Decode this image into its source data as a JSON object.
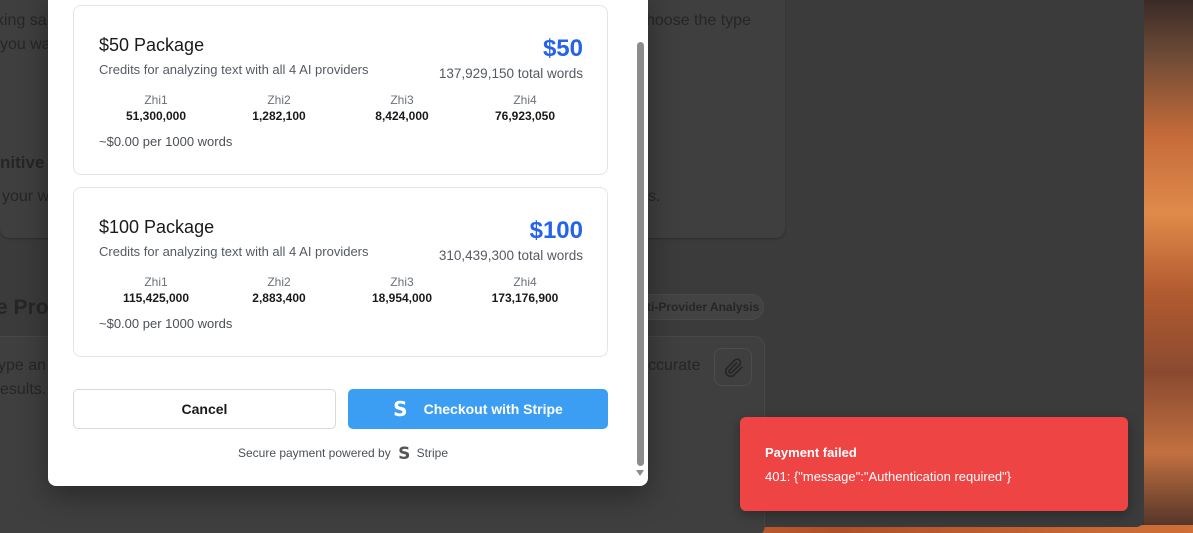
{
  "background": {
    "text_fragments": [
      "king sa",
      "you wa",
      "nitive",
      "your w",
      "e Profi",
      "ype an",
      "esults.",
      "hoose the type",
      "s.",
      "ccurate"
    ],
    "pill_label": "ti-Provider Analysis"
  },
  "modal": {
    "packages": [
      {
        "title": "$50 Package",
        "description": "Credits for analyzing text with all 4 AI providers",
        "price": "$50",
        "total_words": "137,929,150 total words",
        "providers": [
          {
            "name": "Zhi1",
            "value": "51,300,000"
          },
          {
            "name": "Zhi2",
            "value": "1,282,100"
          },
          {
            "name": "Zhi3",
            "value": "8,424,000"
          },
          {
            "name": "Zhi4",
            "value": "76,923,050"
          }
        ],
        "rate": "~$0.00 per 1000 words"
      },
      {
        "title": "$100 Package",
        "description": "Credits for analyzing text with all 4 AI providers",
        "price": "$100",
        "total_words": "310,439,300 total words",
        "providers": [
          {
            "name": "Zhi1",
            "value": "115,425,000"
          },
          {
            "name": "Zhi2",
            "value": "2,883,400"
          },
          {
            "name": "Zhi3",
            "value": "18,954,000"
          },
          {
            "name": "Zhi4",
            "value": "173,176,900"
          }
        ],
        "rate": "~$0.00 per 1000 words"
      }
    ],
    "cancel_label": "Cancel",
    "checkout_label": "Checkout with Stripe",
    "stripe_icon": "S",
    "secure_text": "Secure payment powered by",
    "stripe_brand": "Stripe"
  },
  "toast": {
    "title": "Payment failed",
    "message": "401: {\"message\":\"Authentication required\"}",
    "color": "#ef4444"
  },
  "colors": {
    "accent_price": "#2563eb",
    "stripe_button": "#3b9ef3"
  }
}
